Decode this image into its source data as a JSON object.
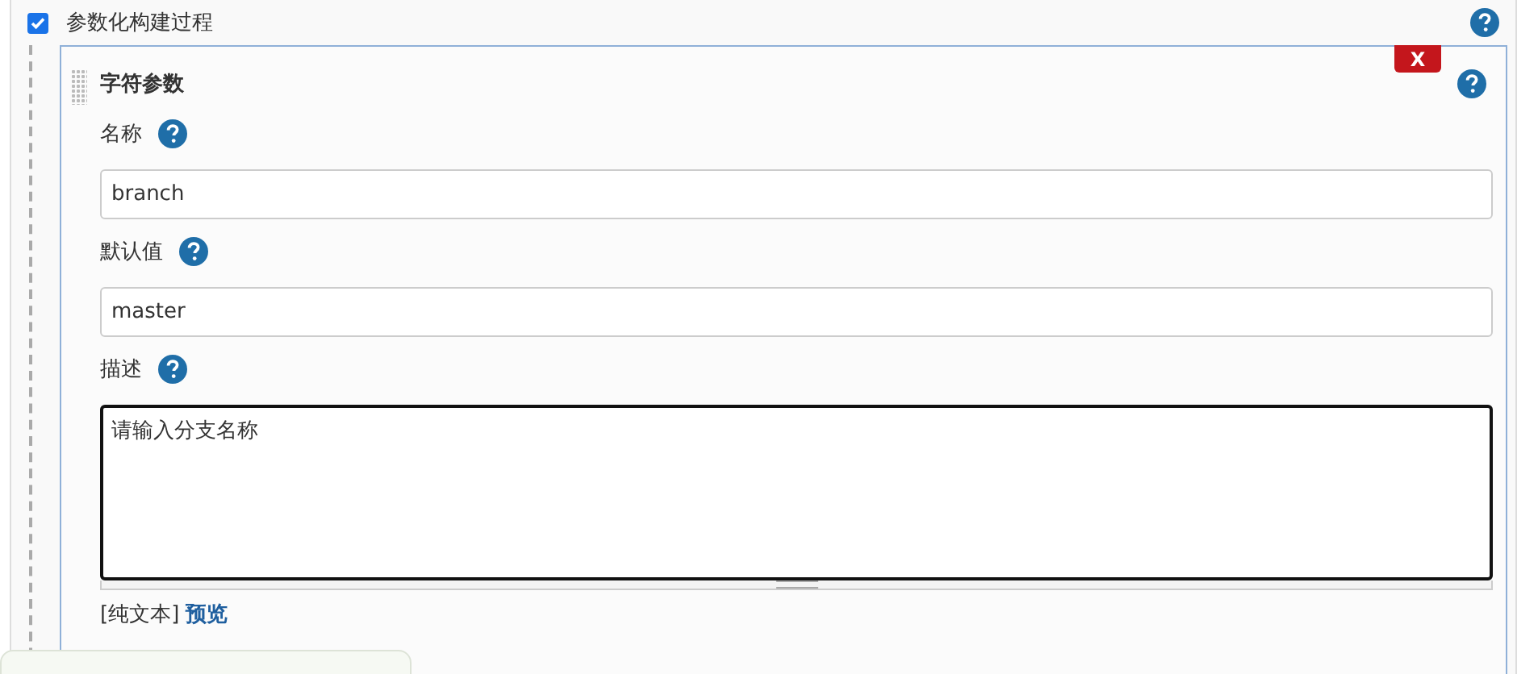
{
  "section": {
    "label": "参数化构建过程",
    "checked": true
  },
  "parameter": {
    "title": "字符参数",
    "delete": "X",
    "fields": [
      {
        "kind": "input",
        "label": "名称",
        "value": "branch"
      },
      {
        "kind": "input",
        "label": "默认值",
        "value": "master"
      },
      {
        "kind": "textarea",
        "label": "描述",
        "value": "请输入分支名称"
      }
    ],
    "format": "[纯文本]",
    "preview": "预览"
  }
}
